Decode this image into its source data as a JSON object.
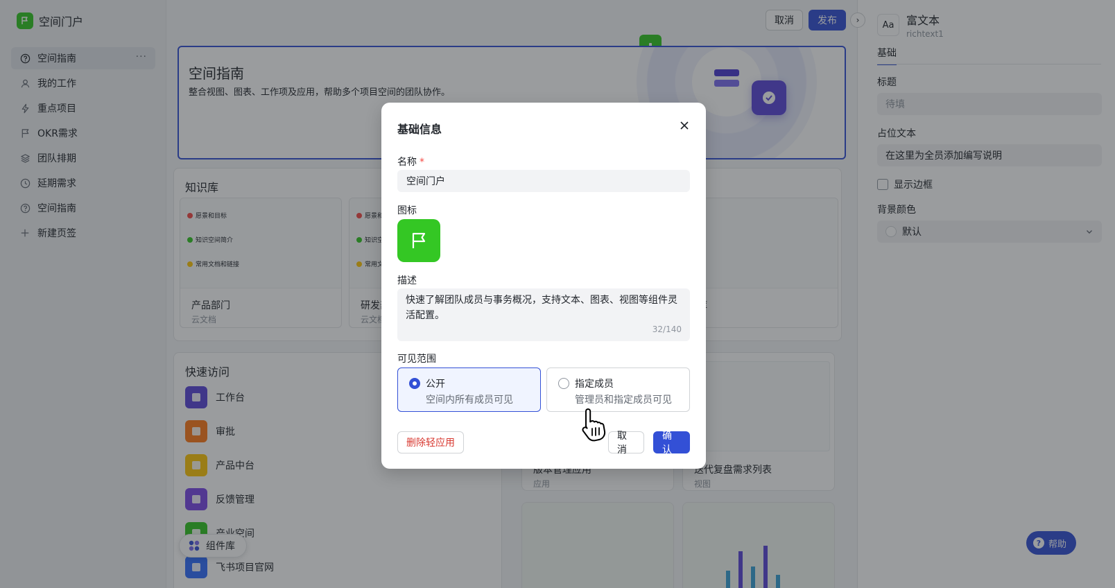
{
  "app": {
    "title": "空间门户"
  },
  "sidebar": {
    "items": [
      {
        "label": "空间指南",
        "icon": "question-circle-icon",
        "active": true
      },
      {
        "label": "我的工作",
        "icon": "user-icon"
      },
      {
        "label": "重点项目",
        "icon": "lightning-icon"
      },
      {
        "label": "OKR需求",
        "icon": "flag-icon"
      },
      {
        "label": "团队排期",
        "icon": "layers-icon"
      },
      {
        "label": "延期需求",
        "icon": "clock-icon"
      },
      {
        "label": "空间指南",
        "icon": "question-circle-icon"
      },
      {
        "label": "新建页签",
        "icon": "plus-icon"
      }
    ],
    "more": "···"
  },
  "toolbar": {
    "cancel": "取消",
    "publish": "发布"
  },
  "hero": {
    "title": "空间指南",
    "desc": "整合视图、图表、工作项及应用，帮助多个项目空间的团队协作。"
  },
  "knowledge": {
    "title": "知识库",
    "preview_lines": [
      "愿景和目标",
      "知识空间简介",
      "常用文档和链接"
    ],
    "docs": [
      {
        "name": "产品部门",
        "type": "云文档"
      },
      {
        "name": "研发部",
        "type": "云文档"
      },
      {
        "name": "识库",
        "type": "档"
      }
    ]
  },
  "quick": {
    "title": "快速访问",
    "items": [
      {
        "label": "工作台",
        "color": "#5b48d9"
      },
      {
        "label": "审批",
        "color": "#ff7a1a"
      },
      {
        "label": "产品中台",
        "color": "#ffc60a"
      },
      {
        "label": "反馈管理",
        "color": "#7d4ae8"
      },
      {
        "label": "产业空间",
        "color": "#34c724"
      },
      {
        "label": "飞书项目官网",
        "color": "#3370ff"
      }
    ]
  },
  "widget_lib": {
    "label": "组件库"
  },
  "apps": [
    {
      "name": "版本管理应用",
      "type": "应用"
    },
    {
      "name": "迭代复盘需求列表",
      "type": "视图"
    }
  ],
  "right_panel": {
    "title": "富文本",
    "subtitle": "richtext1",
    "icon_text": "Aa",
    "tab": "基础",
    "title_label": "标题",
    "title_placeholder": "待填",
    "placeholder_label": "占位文本",
    "placeholder_value": "在这里为全员添加编写说明",
    "border_label": "显示边框",
    "bg_label": "背景颜色",
    "bg_value": "默认"
  },
  "help": {
    "label": "帮助"
  },
  "modal": {
    "title": "基础信息",
    "name_label": "名称",
    "required_mark": "*",
    "name_value": "空间门户",
    "icon_label": "图标",
    "desc_label": "描述",
    "desc_value": "快速了解团队成员与事务概况，支持文本、图表、视图等组件灵活配置。",
    "desc_count": "32/140",
    "scope_label": "可见范围",
    "options": [
      {
        "title": "公开",
        "sub": "空间内所有成员可见",
        "selected": true
      },
      {
        "title": "指定成员",
        "sub": "管理员和指定成员可见",
        "selected": false
      }
    ],
    "delete": "删除轻应用",
    "cancel": "取消",
    "confirm": "确认"
  },
  "colors": {
    "accent": "#3350d6",
    "brand_green": "#34c724",
    "danger": "#d83931"
  }
}
